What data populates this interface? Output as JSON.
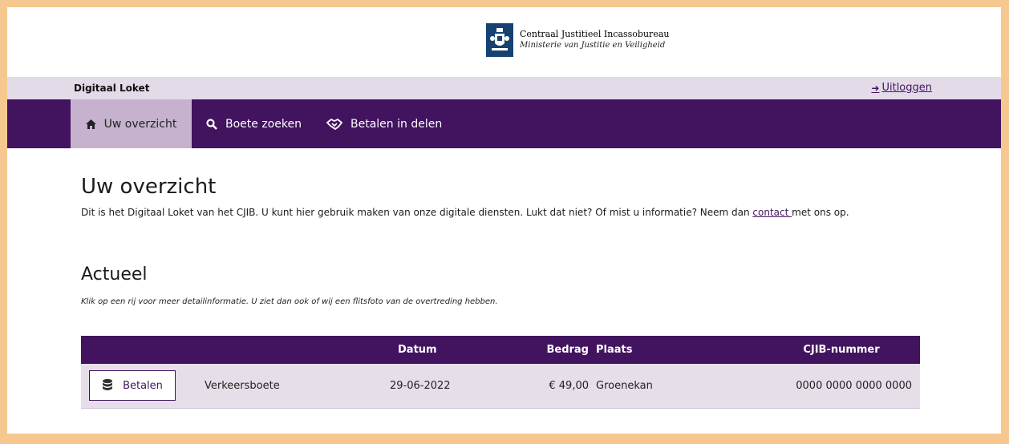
{
  "header": {
    "org_name": "Centraal Justitieel Incassobureau",
    "org_sub": "Ministerie van Justitie en Veiligheid"
  },
  "subbar": {
    "title": "Digitaal Loket",
    "logout": "Uitloggen"
  },
  "nav": {
    "items": [
      {
        "label": "Uw overzicht",
        "icon": "home-icon",
        "active": true
      },
      {
        "label": "Boete zoeken",
        "icon": "search-icon",
        "active": false
      },
      {
        "label": "Betalen in delen",
        "icon": "handshake-icon",
        "active": false
      }
    ]
  },
  "main": {
    "title": "Uw overzicht",
    "intro_before": "Dit is het Digitaal Loket van het CJIB. U kunt hier gebruik maken van onze digitale diensten. Lukt dat niet? Of mist u informatie? Neem dan ",
    "intro_link": "contact ",
    "intro_after": "met ons op.",
    "section_title": "Actueel",
    "section_hint": "Klik op een rij voor meer detailinformatie. U ziet dan ook of wij een flitsfoto van de overtreding hebben."
  },
  "table": {
    "headers": {
      "datum": "Datum",
      "bedrag": "Bedrag",
      "plaats": "Plaats",
      "cjib": "CJIB-nummer"
    },
    "rows": [
      {
        "button": "Betalen",
        "type": "Verkeersboete",
        "datum": "29-06-2022",
        "bedrag": "€ 49,00",
        "plaats": "Groenekan",
        "cjib": "0000 0000 0000 0000"
      }
    ]
  },
  "colors": {
    "brand_purple": "#42145f",
    "active_tab": "#c6b2cf",
    "subbar": "#e3dbe8",
    "row_bg": "#e6dfe9",
    "frame_border": "#f6c890",
    "crest_blue": "#154273"
  }
}
